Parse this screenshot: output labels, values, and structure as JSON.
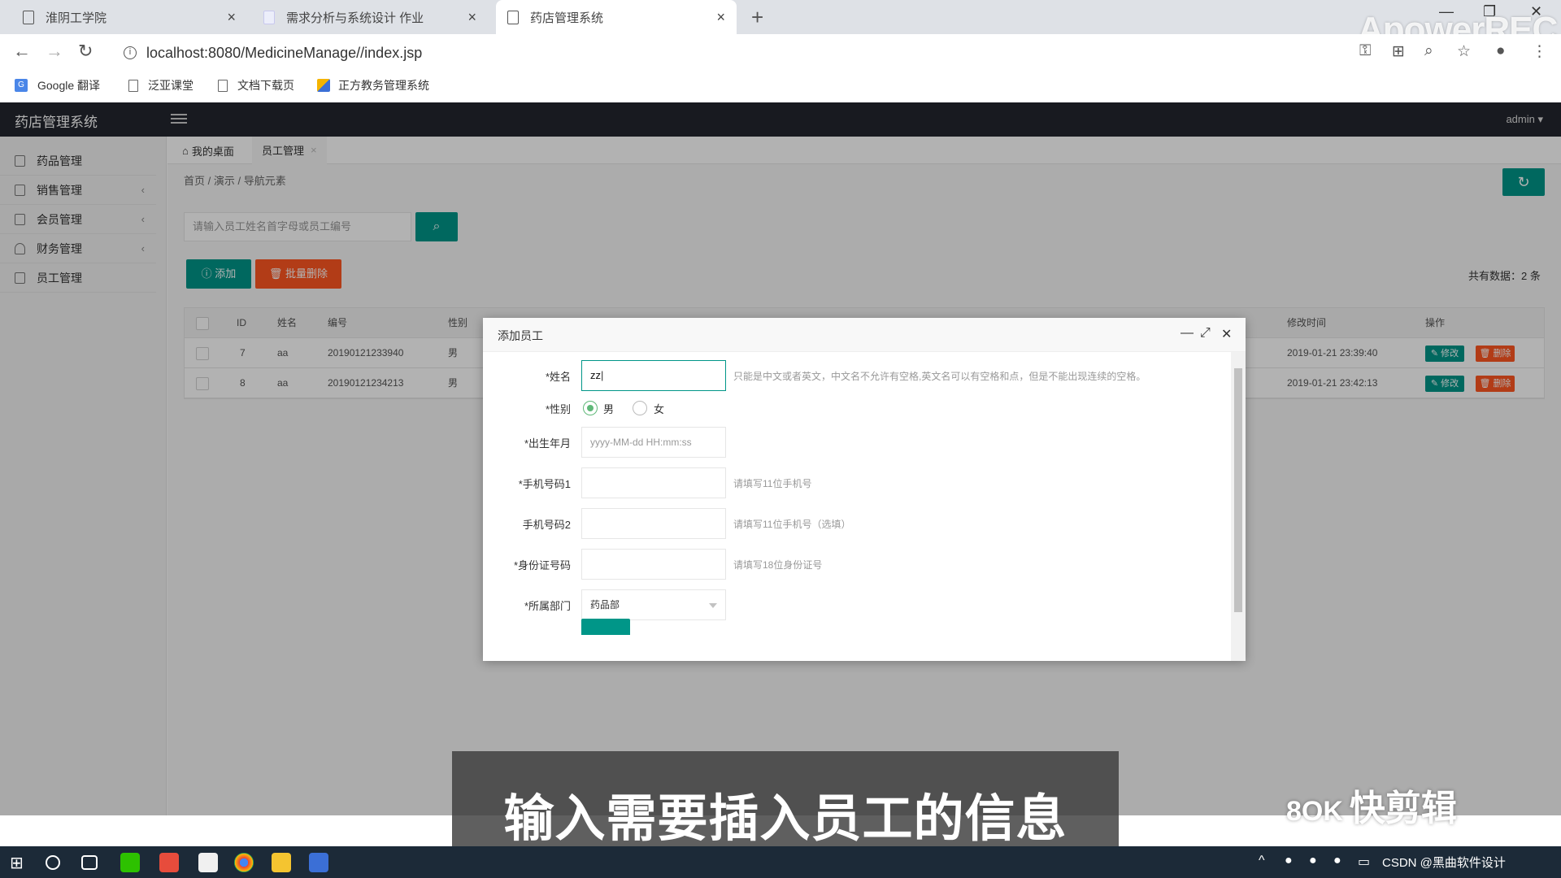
{
  "browser": {
    "tabs": [
      {
        "title": "淮阴工学院"
      },
      {
        "title": "需求分析与系统设计 作业"
      },
      {
        "title": "药店管理系统"
      }
    ],
    "url": "localhost:8080/MedicineManage//index.jsp",
    "bookmarks": [
      {
        "label": "Google 翻译"
      },
      {
        "label": "泛亚课堂"
      },
      {
        "label": "文档下载页"
      },
      {
        "label": "正方教务管理系统"
      }
    ],
    "watermark": "ApowerREC"
  },
  "app": {
    "title": "药店管理系统",
    "user": "admin"
  },
  "sidebar": {
    "items": [
      {
        "label": "药品管理"
      },
      {
        "label": "销售管理"
      },
      {
        "label": "会员管理"
      },
      {
        "label": "财务管理"
      },
      {
        "label": "员工管理"
      }
    ]
  },
  "page_tabs": [
    {
      "label": "我的桌面"
    },
    {
      "label": "员工管理"
    }
  ],
  "breadcrumb": {
    "items": [
      "首页",
      "演示",
      "导航元素"
    ]
  },
  "search": {
    "placeholder": "请输入员工姓名首字母或员工编号"
  },
  "toolbar": {
    "add_label": "添加",
    "batch_delete_label": "批量删除",
    "total_label": "共有数据：2 条"
  },
  "table": {
    "headers": [
      "ID",
      "姓名",
      "编号",
      "性别",
      "修改时间",
      "操作"
    ],
    "rows": [
      {
        "id": "7",
        "name": "aa",
        "code": "20190121233940",
        "gender": "男",
        "modified": "2019-01-21 23:39:40"
      },
      {
        "id": "8",
        "name": "aa",
        "code": "20190121234213",
        "gender": "男",
        "modified": "2019-01-21 23:42:13"
      }
    ],
    "edit_label": "修改",
    "delete_label": "删除"
  },
  "modal": {
    "title": "添加员工",
    "fields": {
      "name": {
        "label": "*姓名",
        "value": "zz",
        "hint": "只能是中文或者英文，中文名不允许有空格,英文名可以有空格和点，但是不能出现连续的空格。"
      },
      "gender": {
        "label": "*性别",
        "options": [
          "男",
          "女"
        ],
        "selected": "男"
      },
      "birth": {
        "label": "*出生年月",
        "placeholder": "yyyy-MM-dd HH:mm:ss"
      },
      "phone1": {
        "label": "*手机号码1",
        "hint": "请填写11位手机号"
      },
      "phone2": {
        "label": "手机号码2",
        "hint": "请填写11位手机号（选填）"
      },
      "idcard": {
        "label": "*身份证号码",
        "hint": "请填写18位身份证号"
      },
      "dept": {
        "label": "*所属部门",
        "value": "药品部"
      }
    }
  },
  "caption": "输入需要插入员工的信息",
  "brand": "快剪辑",
  "tray_text": "CSDN @黑曲软件设计"
}
